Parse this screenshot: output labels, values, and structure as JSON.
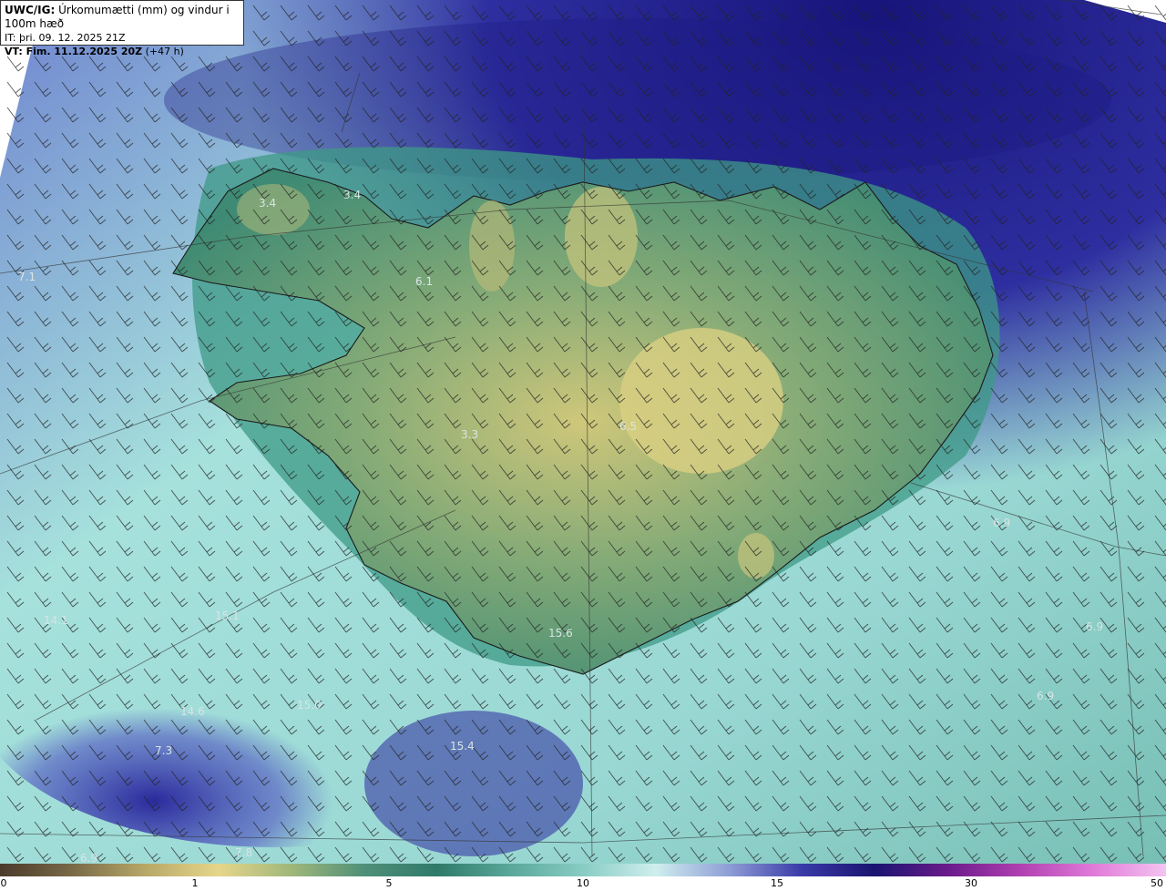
{
  "header": {
    "title_prefix": "UWC/IG:",
    "title_text": "Úrkomumætti (mm) og vindur i 100m hæð",
    "it_line": "IT: þri. 09. 12. 2025 21Z",
    "vt_prefix": "VT: Fim. 11.12.2025 20Z",
    "vt_suffix": "(+47 h)"
  },
  "map_values": [
    "3.4",
    "3.4",
    "7.1",
    "6.1",
    "3.3",
    "6.5",
    "6.9",
    "14.1",
    "15.1",
    "14.6",
    "15.0",
    "7.3",
    "15.4",
    "15.6",
    "6.9",
    "6.9",
    "6.9",
    "7.8"
  ],
  "colorbar": {
    "ticks": [
      "0",
      "1",
      "5",
      "10",
      "15",
      "30",
      "50"
    ],
    "colors": [
      "#4a3a2a",
      "#7a6a48",
      "#b8a868",
      "#e6d68a",
      "#9fb77a",
      "#4f8f78",
      "#2f7a6a",
      "#5aa89a",
      "#88ccc4",
      "#cfeeee",
      "#8e9ed6",
      "#3a3aa8",
      "#1a1470",
      "#6a1a8a",
      "#b040b0",
      "#e07ad8",
      "#f4c4f0"
    ]
  }
}
